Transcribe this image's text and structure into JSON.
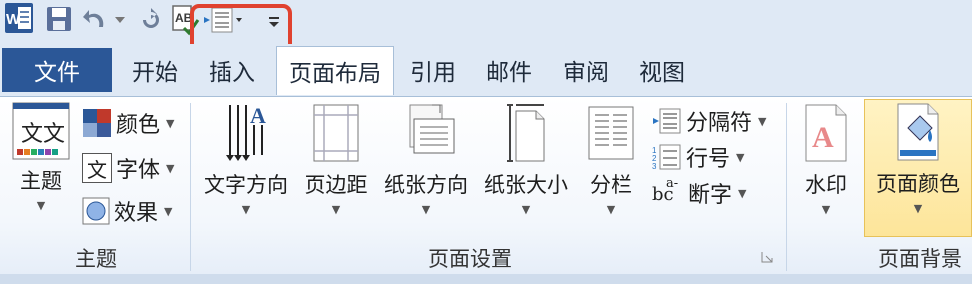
{
  "tabs": {
    "file": "文件",
    "home": "开始",
    "insert": "插入",
    "page_layout": "页面布局",
    "references": "引用",
    "mailings": "邮件",
    "review": "审阅",
    "view": "视图"
  },
  "groups": {
    "themes": {
      "label": "主题",
      "theme_button": "主题",
      "colors": "颜色",
      "fonts": "字体",
      "effects": "效果"
    },
    "page_setup": {
      "label": "页面设置",
      "text_direction": "文字方向",
      "margins": "页边距",
      "orientation": "纸张方向",
      "size": "纸张大小",
      "columns": "分栏",
      "breaks": "分隔符",
      "line_numbers": "行号",
      "hyphenation": "断字"
    },
    "page_background": {
      "label": "页面背景",
      "watermark": "水印",
      "page_color": "页面颜色"
    }
  },
  "icons": {
    "word_logo_letter": "W",
    "theme_sample_text": "文文",
    "fonts_glyph": "文",
    "hyphen_glyph": "bc",
    "hyphen_glyph_sup": "a-",
    "text_direction_glyph": "A"
  },
  "colors": {
    "file_tab": "#2b5797",
    "highlight": "#e0422f",
    "selected_button": "#fde59a"
  }
}
